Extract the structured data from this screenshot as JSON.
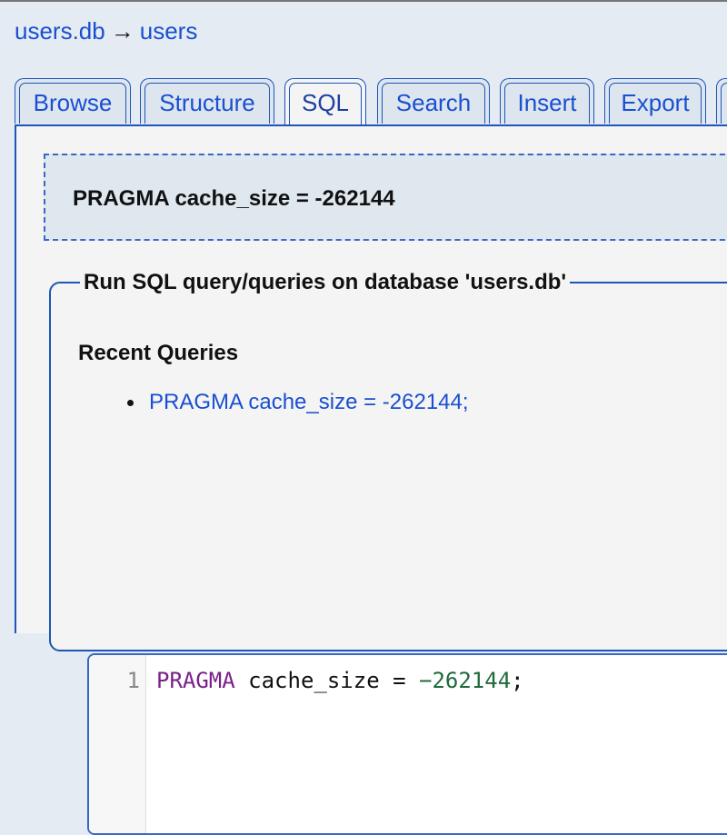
{
  "breadcrumb": {
    "database": "users.db",
    "arrow": "→",
    "table": "users"
  },
  "tabs": [
    {
      "label": "Browse",
      "active": false
    },
    {
      "label": "Structure",
      "active": false
    },
    {
      "label": "SQL",
      "active": true
    },
    {
      "label": "Search",
      "active": false
    },
    {
      "label": "Insert",
      "active": false
    },
    {
      "label": "Export",
      "active": false
    }
  ],
  "executed_query": "PRAGMA cache_size = -262144",
  "form": {
    "legend": "Run SQL query/queries on database 'users.db'",
    "recent_title": "Recent Queries",
    "recent_queries": [
      "PRAGMA cache_size = -262144;"
    ]
  },
  "editor": {
    "line_number": "1",
    "keyword": "PRAGMA",
    "middle": " cache_size = ",
    "number": "−262144",
    "end": ";"
  },
  "colors": {
    "link": "#1a4fd0",
    "border": "#1d55b8",
    "keyword": "#7b1f8a",
    "number": "#1e6b3a"
  }
}
